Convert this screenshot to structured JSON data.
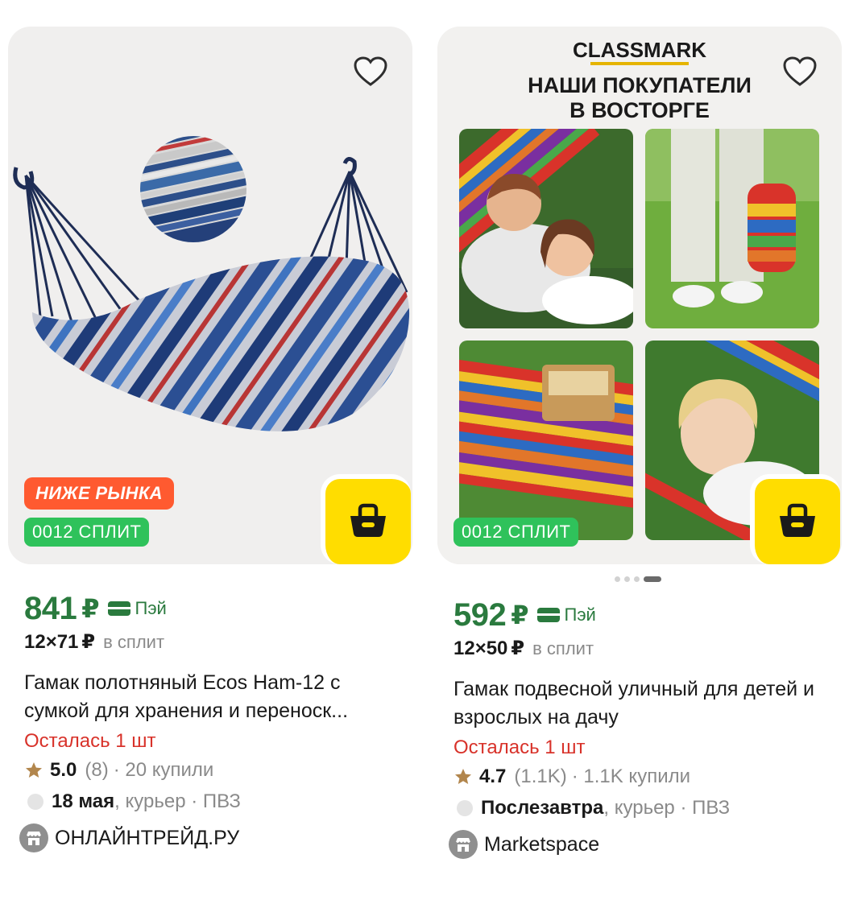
{
  "products": [
    {
      "price": "841",
      "currency": "₽",
      "pay_label": "Пэй",
      "split_amount": "12×71",
      "split_currency": "₽",
      "split_label": "в сплит",
      "title": "Гамак полотняный Ecos Ham-12 с сумкой для хранения и переноск...",
      "stock": "Осталась 1 шт",
      "rating": "5.0",
      "reviews": "(8)",
      "purchases": "· 20 купили",
      "delivery_date": "18 мая",
      "delivery_method": ", курьер · ПВЗ",
      "shop": "ОНЛАЙНТРЕЙД.РУ",
      "badge_market": "НИЖЕ РЫНКА",
      "badge_split": "0012 СПЛИТ"
    },
    {
      "price": "592",
      "currency": "₽",
      "pay_label": "Пэй",
      "split_amount": "12×50",
      "split_currency": "₽",
      "split_label": "в сплит",
      "title": "Гамак подвесной уличный для детей и взрослых на дачу",
      "stock": "Осталась 1 шт",
      "rating": "4.7",
      "reviews": "(1.1K)",
      "purchases": "· 1.1K купили",
      "delivery_date": "Послезавтра",
      "delivery_method": ", курьер · ПВЗ",
      "shop": "Marketspace",
      "badge_split": "0012 СПЛИТ",
      "promo_brand": "CLASSMARK",
      "promo_line1": "НАШИ ПОКУПАТЕЛИ",
      "promo_line2": "В ВОСТОРГЕ"
    }
  ],
  "colors": {
    "price_green": "#2a7a3e",
    "stock_red": "#d8322a",
    "cart_yellow": "#ffdd00",
    "badge_orange": "#ff5a30",
    "badge_green": "#2fc25b"
  },
  "icons": [
    "heart-icon",
    "basket-icon",
    "pay-card-icon",
    "star-icon",
    "shop-icon"
  ]
}
